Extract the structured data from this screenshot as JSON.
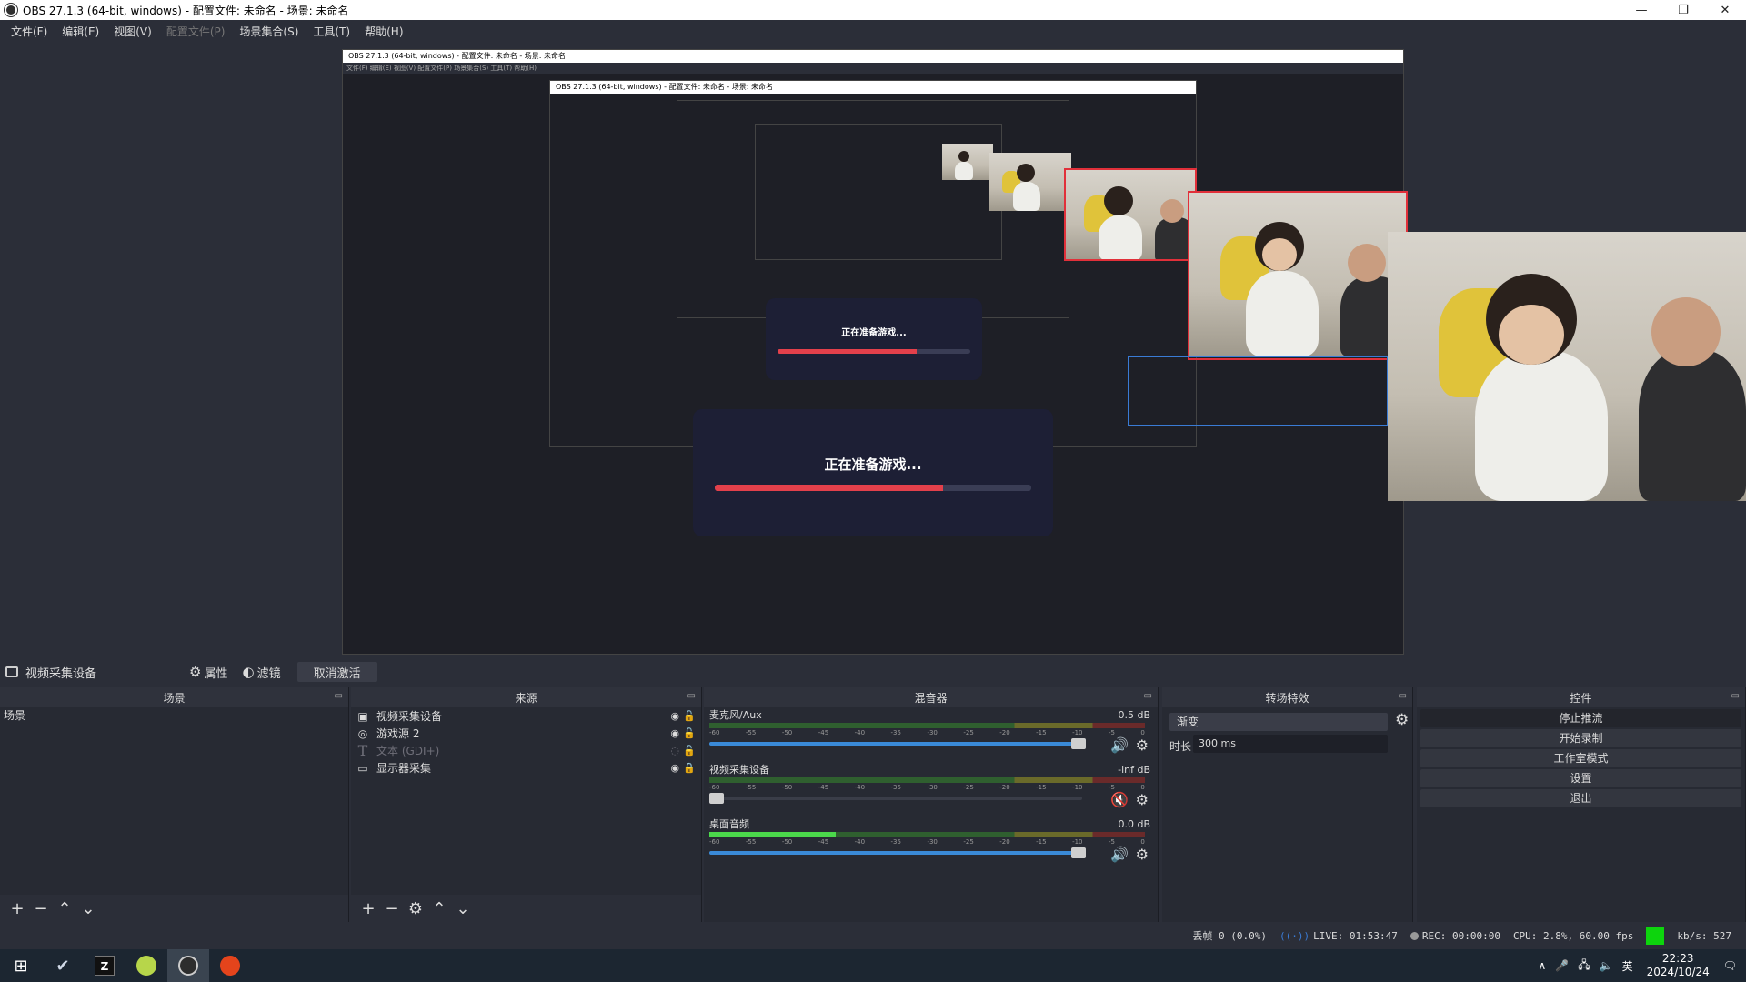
{
  "window": {
    "title": "OBS 27.1.3 (64-bit, windows) - 配置文件: 未命名 - 场景: 未命名",
    "minimize": "—",
    "maximize": "❐",
    "close": "✕"
  },
  "menu": [
    {
      "label": "文件(F)",
      "enabled": true
    },
    {
      "label": "编辑(E)",
      "enabled": true
    },
    {
      "label": "视图(V)",
      "enabled": true
    },
    {
      "label": "配置文件(P)",
      "enabled": false
    },
    {
      "label": "场景集合(S)",
      "enabled": true
    },
    {
      "label": "工具(T)",
      "enabled": true
    },
    {
      "label": "帮助(H)",
      "enabled": true
    }
  ],
  "preview": {
    "nested_title": "OBS 27.1.3 (64-bit, windows) - 配置文件: 未命名 - 场景: 未命名",
    "nested_menu": "文件(F)   编辑(E)   视图(V)   配置文件(P)   场景集合(S)   工具(T)   帮助(H)",
    "dialog_text": "正在准备游戏...",
    "dialog_progress": 0.72
  },
  "toolbar": {
    "source_name": "视频采集设备",
    "properties": "属性",
    "filters": "滤镜",
    "deactivate": "取消激活"
  },
  "scenes": {
    "header": "场景",
    "items": [
      "场景"
    ]
  },
  "sources": {
    "header": "来源",
    "items": [
      {
        "icon": "camera-icon",
        "glyph": "▣",
        "name": "视频采集设备",
        "visible": true,
        "locked": false
      },
      {
        "icon": "gamepad-icon",
        "glyph": "◉",
        "name": "游戏源 2",
        "visible": true,
        "locked": false
      },
      {
        "icon": "text-icon",
        "glyph": "T",
        "name": "文本 (GDI+)",
        "visible": false,
        "locked": false
      },
      {
        "icon": "monitor-icon",
        "glyph": "▭",
        "name": "显示器采集",
        "visible": true,
        "locked": true
      }
    ]
  },
  "mixer": {
    "header": "混音器",
    "scale": [
      "-60",
      "-55",
      "-50",
      "-45",
      "-40",
      "-35",
      "-30",
      "-25",
      "-20",
      "-15",
      "-10",
      "-5",
      "0"
    ],
    "channels": [
      {
        "name": "麦克风/Aux",
        "db": "0.5 dB",
        "level": 0.0,
        "volume": 1.0,
        "muted": false
      },
      {
        "name": "视频采集设备",
        "db": "-inf dB",
        "level": 0.0,
        "volume": 0.0,
        "muted": true
      },
      {
        "name": "桌面音频",
        "db": "0.0 dB",
        "level": 0.29,
        "volume": 1.0,
        "muted": false
      }
    ]
  },
  "transitions": {
    "header": "转场特效",
    "selected": "渐变",
    "duration_label": "时长",
    "duration": "300 ms"
  },
  "controls": {
    "header": "控件",
    "buttons": [
      "停止推流",
      "开始录制",
      "工作室模式",
      "设置",
      "退出"
    ]
  },
  "status": {
    "dropped": "丢帧 0 (0.0%)",
    "live": "LIVE: 01:53:47",
    "rec": "REC: 00:00:00",
    "cpu": "CPU: 2.8%, 60.00 fps",
    "kbps": "kb/s: 527",
    "indicator_color": "#0dd40d"
  },
  "taskbar": {
    "apps": [
      "windows-start-icon",
      "steam-icon",
      "zapp-icon",
      "green-app-icon",
      "obs-icon",
      "ea-icon"
    ],
    "ime": "英",
    "time": "22:23",
    "date": "2024/10/24"
  }
}
